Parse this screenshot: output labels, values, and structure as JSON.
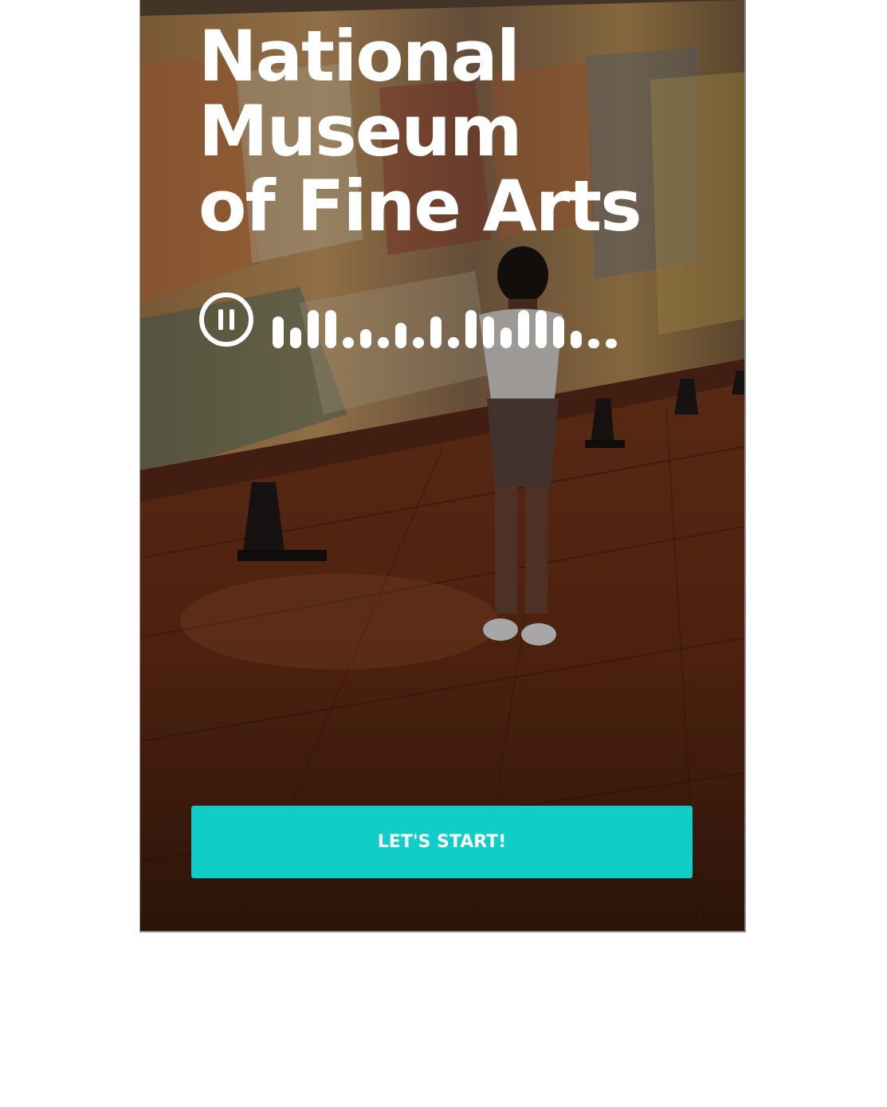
{
  "hero": {
    "title": "National\nMuseum\nof Fine Arts",
    "background_description_icon": "museum-gallery-photo"
  },
  "audio_player": {
    "state": "playing",
    "control_icon": "pause-icon"
  },
  "cta": {
    "label": "LET'S START!",
    "color": "#10cdc7"
  }
}
